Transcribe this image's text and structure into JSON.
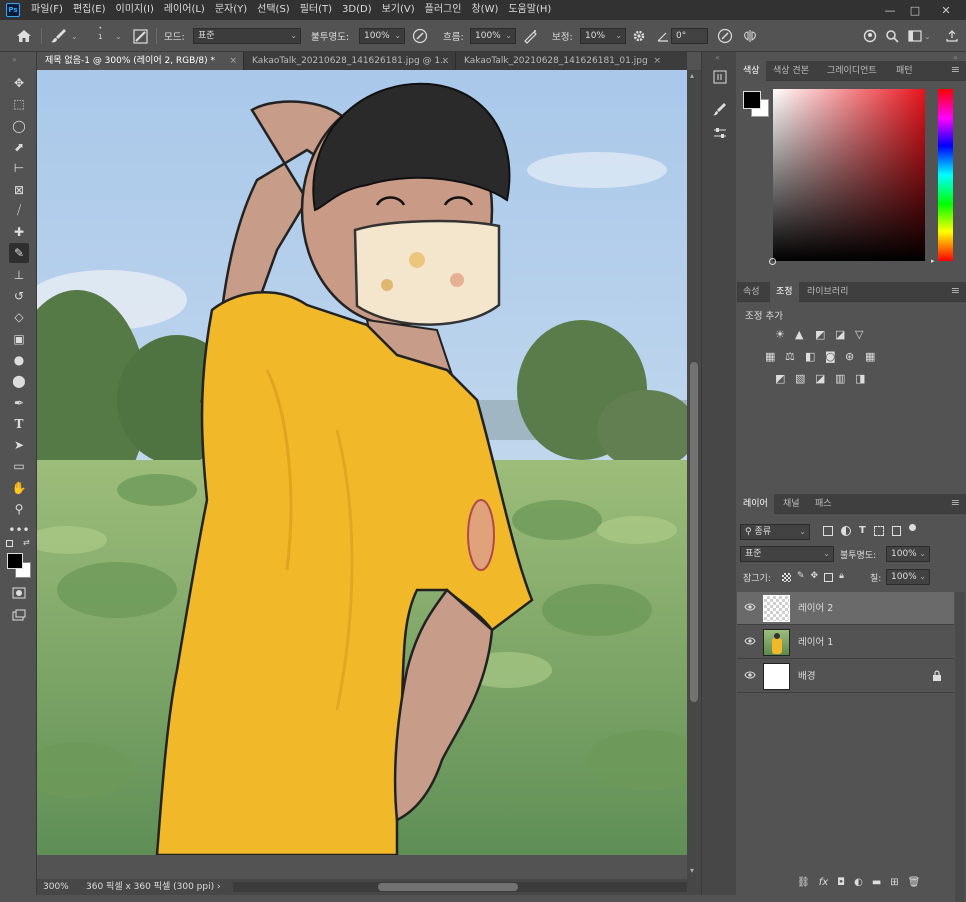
{
  "app": {
    "logo": "Ps"
  },
  "menu": [
    "파일(F)",
    "편집(E)",
    "이미지(I)",
    "레이어(L)",
    "문자(Y)",
    "선택(S)",
    "필터(T)",
    "3D(D)",
    "보기(V)",
    "플러그인",
    "창(W)",
    "도움말(H)"
  ],
  "window_controls": {
    "minimize": "—",
    "maximize": "□",
    "close": "✕"
  },
  "options": {
    "brush_size": "1",
    "mode_label": "모드:",
    "mode_value": "표준",
    "opacity_label": "불투명도:",
    "opacity_value": "100%",
    "flow_label": "흐름:",
    "flow_value": "100%",
    "smoothing_label": "보정:",
    "smoothing_value": "10%",
    "angle_value": "0°"
  },
  "tabs": [
    {
      "label": "제목 없음-1 @ 300% (레이어 2, RGB/8) *",
      "active": true
    },
    {
      "label": "KakaoTalk_20210628_141626181.jpg @ 1...",
      "active": false
    },
    {
      "label": "KakaoTalk_20210628_141626181_01.jpg",
      "active": false
    }
  ],
  "tab_close": "×",
  "status": {
    "zoom": "300%",
    "doc_info": "360 픽셀 x 360 픽셀 (300 ppi)",
    "arrow": "›"
  },
  "panel_tabs_top": [
    "색상",
    "색상 견본",
    "그레이디언트",
    "패턴"
  ],
  "panel_tabs_mid": [
    "속성",
    "조정",
    "라이브러리"
  ],
  "adjustments_title": "조정 추가",
  "panel_tabs_layers": [
    "레이어",
    "채널",
    "패스"
  ],
  "layers_panel": {
    "filter_label": "종류",
    "blend_mode": "표준",
    "opacity_label": "불투명도:",
    "opacity_value": "100%",
    "lock_label": "잠그기:",
    "fill_label": "칠:",
    "fill_value": "100%"
  },
  "layers": [
    {
      "name": "레이어 2",
      "selected": true,
      "locked": false
    },
    {
      "name": "레이어 1",
      "selected": false,
      "locked": false
    },
    {
      "name": "배경",
      "selected": false,
      "locked": true
    }
  ],
  "colors": {
    "accent": "#31a8ff",
    "foreground": "#000000",
    "background": "#ffffff",
    "picker_hue": "#e8141c",
    "shirt": "#f1b92a"
  }
}
